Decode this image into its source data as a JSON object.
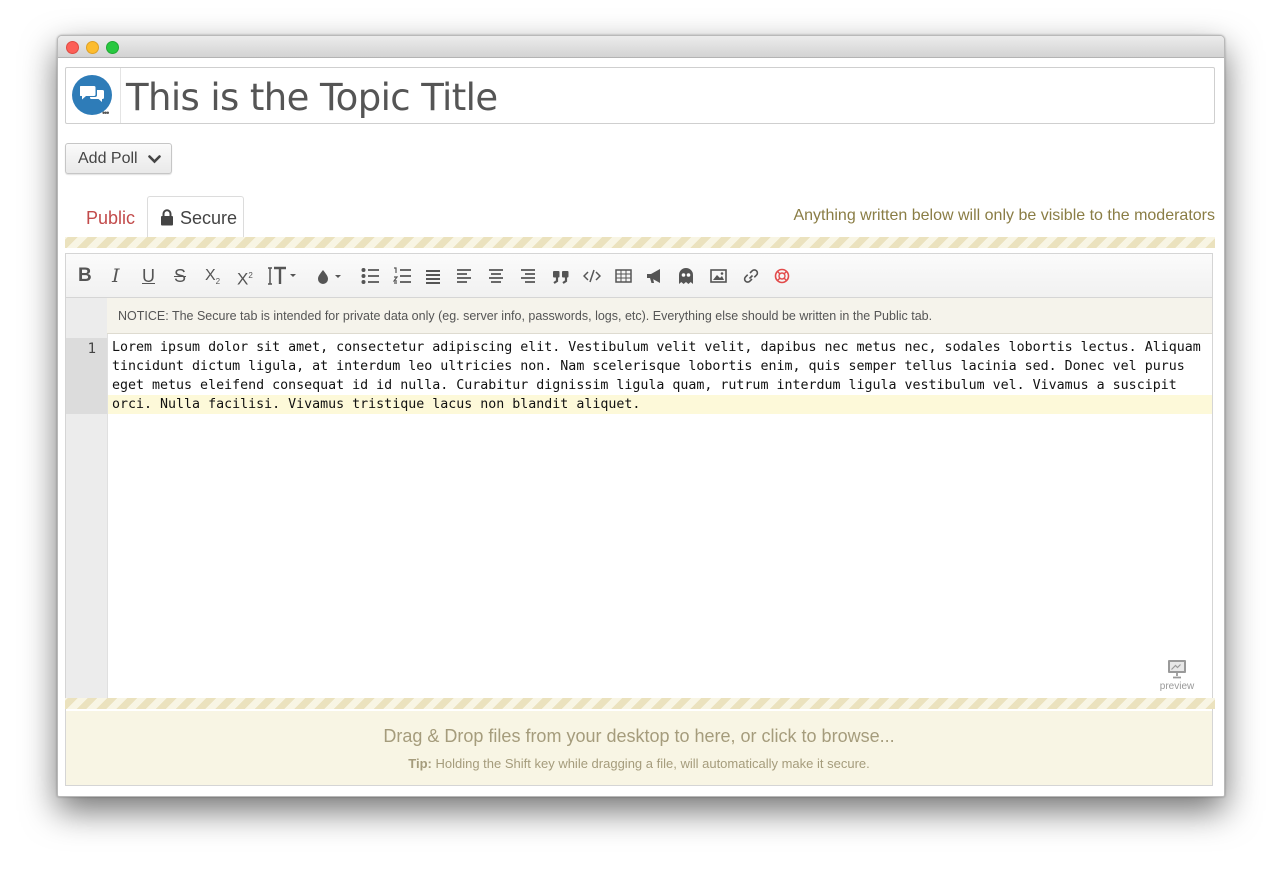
{
  "window": {
    "controls": [
      "close",
      "minimize",
      "maximize"
    ]
  },
  "topic": {
    "title": "This is the Topic Title",
    "avatar_icon": "chat-bubbles-icon",
    "avatar_color": "#2e7cb8",
    "avatar_dots": "•••"
  },
  "poll": {
    "add_label": "Add Poll",
    "chevron_icon": "chevron-down-icon"
  },
  "tabs": [
    {
      "label": "Public",
      "active": false
    },
    {
      "label": "Secure",
      "active": true,
      "icon": "lock-icon"
    }
  ],
  "moderator_note": "Anything written below will only be visible to the moderators",
  "toolbar": {
    "buttons": [
      "bold",
      "italic",
      "underline",
      "strikethrough",
      "subscript",
      "superscript",
      "text-height",
      "color",
      "bullet-list",
      "numbered-list",
      "justify",
      "align-left",
      "align-center",
      "align-right",
      "quote",
      "code",
      "table",
      "announce",
      "spoiler",
      "image",
      "link",
      "help"
    ]
  },
  "notice": "NOTICE: The Secure tab is intended for private data only (eg. server info, passwords, logs, etc). Everything else should be written in the Public tab.",
  "editor": {
    "line_number": "1",
    "lines": [
      "Lorem ipsum dolor sit amet, consectetur adipiscing elit. Vestibulum velit velit, dapibus nec metus nec, sodales lobortis lectus. Aliquam",
      "tincidunt dictum ligula, at interdum leo ultricies non. Nam scelerisque lobortis enim, quis semper tellus lacinia sed. Donec vel purus",
      "eget metus eleifend consequat id id nulla. Curabitur dignissim ligula quam, rutrum interdum ligula vestibulum vel. Vivamus a suscipit",
      "orci. Nulla facilisi. Vivamus tristique lacus non blandit aliquet."
    ]
  },
  "preview": {
    "label": "preview",
    "icon": "monitor-icon"
  },
  "dropzone": {
    "main": "Drag & Drop files from your desktop to here, or click to browse...",
    "tip_label": "Tip:",
    "tip_text": " Holding the Shift key while dragging a file, will automatically make it secure."
  }
}
